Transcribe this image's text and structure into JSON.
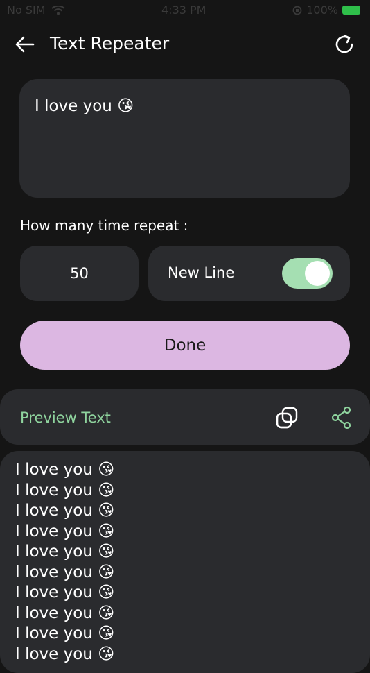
{
  "status_bar": {
    "carrier": "No SIM",
    "time": "4:33 PM",
    "battery": "100%"
  },
  "header": {
    "title": "Text Repeater"
  },
  "input": {
    "text": "I love you 😘"
  },
  "repeat": {
    "label": "How many time repeat :",
    "count": "50",
    "new_line_label": "New Line",
    "new_line_enabled": true
  },
  "done_label": "Done",
  "preview": {
    "label": "Preview Text",
    "lines": [
      "I love you 😘",
      "I love you 😘",
      "I love you 😘",
      "I love you 😘",
      "I love you 😘",
      "I love you 😘",
      "I love you 😘",
      "I love you 😘",
      "I love you 😘",
      "I love you 😘"
    ]
  },
  "colors": {
    "background": "#151515",
    "card": "#2a2b2e",
    "accent_green": "#8fd49e",
    "toggle_on": "#a5dfb2",
    "button_pink": "#dcb7e2",
    "battery_green": "#2fbf4a"
  },
  "icons": {
    "back": "arrow-left-icon",
    "refresh": "refresh-icon",
    "copy": "copy-icon",
    "share": "share-icon",
    "wifi": "wifi-icon"
  }
}
